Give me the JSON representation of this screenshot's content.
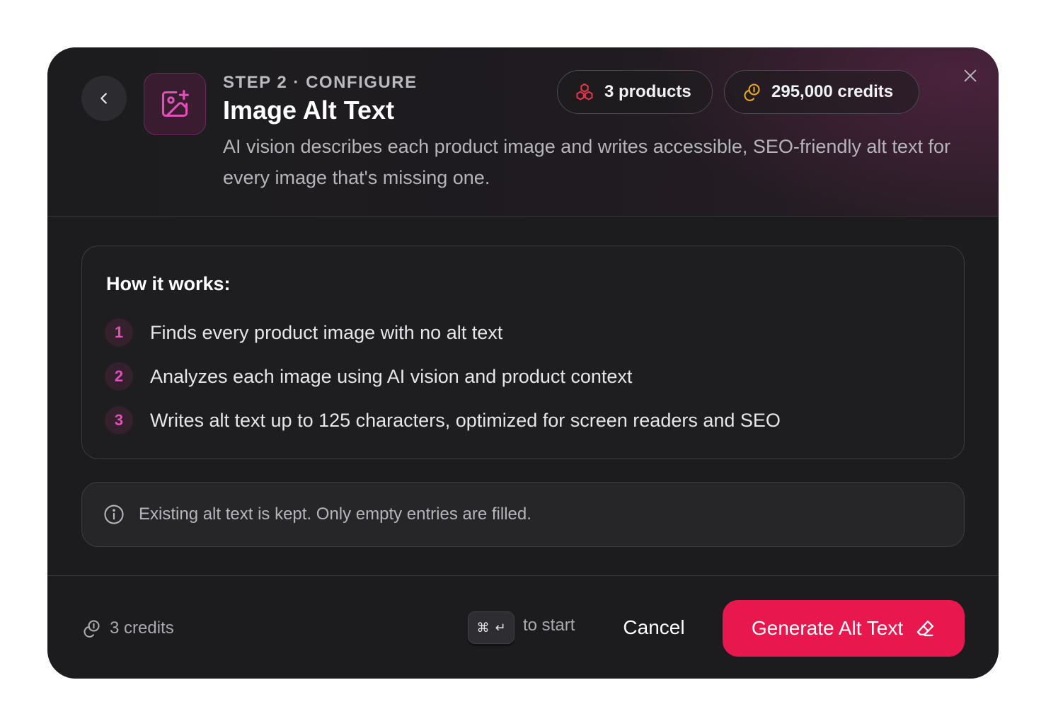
{
  "header": {
    "step_label": "STEP 2 · CONFIGURE",
    "title": "Image Alt Text",
    "description": "AI vision describes each product image and writes accessible, SEO-friendly alt text for every image that's missing one.",
    "products_pill": "3 products",
    "credits_pill": "295,000 credits",
    "icons": {
      "back": "chevron-left-icon",
      "feature": "image-plus-icon",
      "products": "boxes-icon",
      "credits": "coins-icon",
      "close": "close-icon"
    }
  },
  "how_it_works": {
    "title": "How it works:",
    "steps": [
      {
        "num": "1",
        "text": "Finds every product image with no alt text"
      },
      {
        "num": "2",
        "text": "Analyzes each image using AI vision and product context"
      },
      {
        "num": "3",
        "text": "Writes alt text up to 125 characters, optimized for screen readers and SEO"
      }
    ]
  },
  "info": {
    "icon": "info-icon",
    "text": "Existing alt text is kept. Only empty entries are filled."
  },
  "footer": {
    "cost": "3 credits",
    "shortcut_keys": [
      "⌘",
      "↵"
    ],
    "shortcut_hint": "to start",
    "cancel_label": "Cancel",
    "generate_label": "Generate Alt Text"
  },
  "colors": {
    "modal_bg": "#1c1c1e",
    "accent": "#e8184f",
    "feature_icon": "#e24fb8",
    "products_icon": "#e5354d",
    "credits_icon": "#e8a81c"
  }
}
